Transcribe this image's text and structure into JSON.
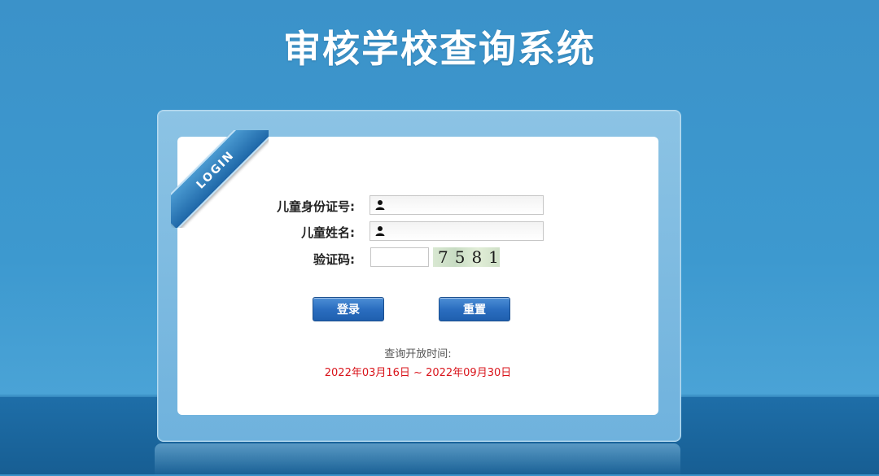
{
  "title": "审核学校查询系统",
  "ribbon": "LOGIN",
  "form": {
    "id_label": "儿童身份证号:",
    "id_value": "",
    "name_label": "儿童姓名:",
    "name_value": "",
    "captcha_label": "验证码:",
    "captcha_value": "",
    "captcha_image_text": "7581"
  },
  "buttons": {
    "login": "登录",
    "reset": "重置"
  },
  "schedule": {
    "label": "查询开放时间:",
    "range": "2022年03月16日 ~ 2022年09月30日"
  },
  "colors": {
    "accent": "#2b6ec0",
    "date": "#d9141b"
  }
}
